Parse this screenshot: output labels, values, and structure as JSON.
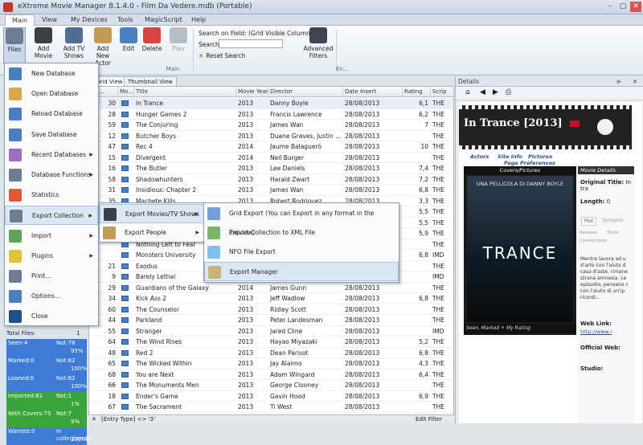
{
  "window": {
    "title": "eXtreme Movie Manager 8.1.4.0 - Film Da Vedere.mdb (Portable)",
    "min": "–",
    "restore": "▢",
    "close": "✕"
  },
  "menu_tabs": [
    "Main",
    "View",
    "My Devices",
    "Tools",
    "MagicScript",
    "Help"
  ],
  "ribbon": {
    "buttons": [
      "Files",
      "Add Movie",
      "Add TV Shows",
      "Add New Actor",
      "Edit",
      "Delete",
      "Play"
    ],
    "search_field_label": "Search on Field: (Grid Visible Columns)",
    "search_label": "Search",
    "search_value": "",
    "reset_label": "Reset Search",
    "advanced_label": "Advanced Filters",
    "group_main": "Main",
    "group_en": "En..."
  },
  "view_tabs": [
    "Grid View",
    "Thumbnail View"
  ],
  "grid": {
    "columns": [
      "Mo...",
      "Mo...",
      "Title",
      "Movie Year",
      "Director",
      "Date Insert",
      "Rating",
      "Scrip"
    ],
    "rows": [
      [
        "30",
        "In Trance",
        "2013",
        "Danny Boyle",
        "28/08/2013",
        "6,1",
        "THE"
      ],
      [
        "28",
        "Hunger Games 2",
        "2013",
        "Francis Lawrence",
        "28/08/2013",
        "6,2",
        "THE"
      ],
      [
        "59",
        "The Conjuring",
        "2013",
        "James Wan",
        "28/08/2013",
        "7",
        "THE"
      ],
      [
        "12",
        "Butcher Boys",
        "2013",
        "Duane Graves, Justin ...",
        "28/08/2013",
        "",
        "THE"
      ],
      [
        "47",
        "Rec 4",
        "2014",
        "Jaume Balagueró",
        "28/08/2013",
        "10",
        "THE"
      ],
      [
        "15",
        "Divergent",
        "2014",
        "Neil Burger",
        "28/08/2013",
        "",
        "THE"
      ],
      [
        "16",
        "The Butler",
        "2013",
        "Lee Daniels",
        "28/08/2013",
        "7,4",
        "THE"
      ],
      [
        "58",
        "Shadowhunters",
        "2013",
        "Harald Zwart",
        "28/08/2013",
        "7,2",
        "THE"
      ],
      [
        "31",
        "Insidious: Chapter 2",
        "2013",
        "James Wan",
        "28/08/2013",
        "6,8",
        "THE"
      ],
      [
        "35",
        "Machete Kills",
        "2013",
        "Robert Rodriguez",
        "28/08/2013",
        "3,3",
        "THE"
      ],
      [
        "",
        "",
        "",
        "",
        "",
        "5,5",
        "THE"
      ],
      [
        "",
        "",
        "",
        "",
        "",
        "5,5",
        "THE"
      ],
      [
        "",
        "",
        "",
        "",
        "",
        "5,9",
        "THE"
      ],
      [
        "",
        "Nothing Left to Fear",
        "",
        "",
        "",
        "",
        "THE"
      ],
      [
        "",
        "Monsters University",
        "",
        "",
        "",
        "6,8",
        "IMD"
      ],
      [
        "21",
        "Exodus",
        "",
        "",
        "",
        "",
        "THE"
      ],
      [
        "9",
        "Barely Lethal",
        "",
        "",
        "",
        "",
        "IMD"
      ],
      [
        "29",
        "Guardians of the Galaxy",
        "2014",
        "James Gunn",
        "28/08/2013",
        "",
        "THE"
      ],
      [
        "34",
        "Kick Ass 2",
        "2013",
        "Jeff Wadlow",
        "28/08/2013",
        "6,8",
        "THE"
      ],
      [
        "60",
        "The Counselor",
        "2013",
        "Ridley Scott",
        "28/08/2013",
        "",
        "THE"
      ],
      [
        "44",
        "Parkland",
        "2013",
        "Peter Landesman",
        "28/08/2013",
        "",
        "THE"
      ],
      [
        "55",
        "Stranger",
        "2013",
        "Jared Cline",
        "28/08/2013",
        "",
        "IMD"
      ],
      [
        "64",
        "The Wind Rises",
        "2013",
        "Hayao Miyazaki",
        "28/08/2013",
        "5,2",
        "THE"
      ],
      [
        "48",
        "Red 2",
        "2013",
        "Dean Parisot",
        "28/08/2013",
        "6,8",
        "THE"
      ],
      [
        "65",
        "The Wicked Within",
        "2013",
        "Jay Alaimo",
        "28/08/2013",
        "4,3",
        "THE"
      ],
      [
        "68",
        "You are Next",
        "2013",
        "Adam Wingard",
        "28/08/2013",
        "6,4",
        "THE"
      ],
      [
        "66",
        "The Monuments Men",
        "2013",
        "George Clooney",
        "28/08/2013",
        "",
        "THE"
      ],
      [
        "18",
        "Ender's Game",
        "2013",
        "Gavin Hood",
        "28/08/2013",
        "6,9",
        "THE"
      ],
      [
        "67",
        "The Sacrament",
        "2013",
        "Ti West",
        "28/08/2013",
        "",
        "THE"
      ]
    ],
    "bottom_left": "[Entry Type] <> '3'",
    "bottom_right": "Edit Filter"
  },
  "left_stats": {
    "total_label": "Total Files:",
    "total_value": "1",
    "items": [
      {
        "a": "Seen:4",
        "b": "Not:78",
        "p": "95%",
        "color": "#3d7bd6"
      },
      {
        "a": "Marked:0",
        "b": "Not:82",
        "p": "100%",
        "color": "#3d7bd6"
      },
      {
        "a": "Loaned:0",
        "b": "Not:82",
        "p": "100%",
        "color": "#3d7bd6"
      },
      {
        "a": "Imported:81",
        "b": "Not:1",
        "p": "1%",
        "color": "#3aa33a"
      },
      {
        "a": "With Covers:75",
        "b": "Not:7",
        "p": "9%",
        "color": "#3aa33a"
      },
      {
        "a": "Wanted:0",
        "b": "In collection:82",
        "p": "100%",
        "color": "#3d7bd6"
      }
    ]
  },
  "files_menu": [
    "New Database",
    "Open Database",
    "Reload Database",
    "Save Database",
    "Recent Databases",
    "Database Functions",
    "Statistics",
    "Export Collection",
    "Import",
    "Plugins",
    "Print...",
    "Options...",
    "Close"
  ],
  "export_submenu": [
    "Export Movies/TV Shows",
    "Export People"
  ],
  "export_movies_submenu": [
    "Grid Export (You can Export in any format in the Preview)",
    "Export Collection to XML File",
    "NFO File Export",
    "Export Manager"
  ],
  "details": {
    "header": "Details",
    "film_title": "In Trance [2013]",
    "links": [
      "Actors",
      "Site Info",
      "Pictures",
      "Page Preferences"
    ],
    "covers_label": "Covers/Pictures",
    "movie_details_label": "Movie Details",
    "poster_tagline": "UNA PELLICOLA DI DANNY BOYLE",
    "poster_word": "TRANCE",
    "seen_label": "Seen, Marked + My Rating",
    "original_title_label": "Original Title:",
    "original_title_value": "In tra",
    "length_label": "Length:",
    "length_value": "0",
    "plot_tabs": [
      "Plot",
      "Synopsis",
      "Reviews",
      "Trivia",
      "Connections"
    ],
    "plot_text": "Mentre lavora ad u d'arte con l'aiuto d casa d'aste, rimane strana amnesia. Le episodio, pensano c con l'aiuto di un'ip ricordi...",
    "web_link_label": "Web Link:",
    "web_link_value": "http://www.i",
    "official_web_label": "Official Web:",
    "studio_label": "Studio:"
  }
}
